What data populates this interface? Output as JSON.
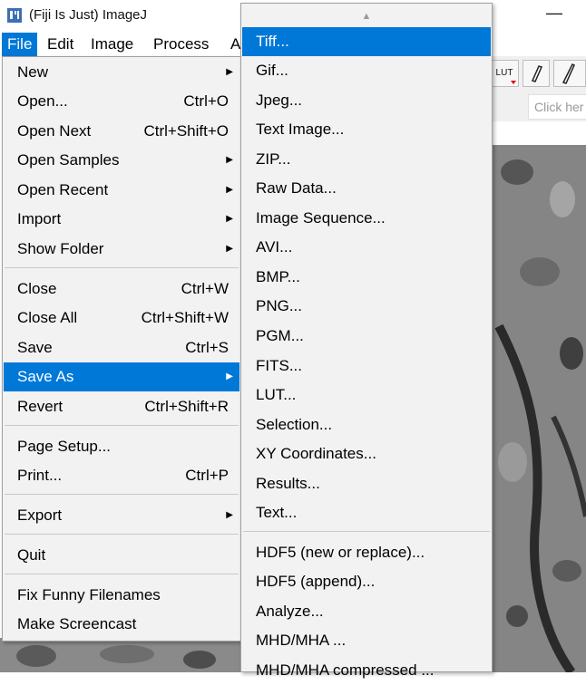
{
  "window": {
    "title": "(Fiji Is Just) ImageJ",
    "minimize_glyph": "—",
    "icon": "fiji-icon"
  },
  "menubar": {
    "items": [
      "File",
      "Edit",
      "Image",
      "Process",
      "A"
    ]
  },
  "toolbar": {
    "lut_label": "LUT",
    "search_placeholder": "Click her"
  },
  "file_menu": {
    "items": [
      {
        "label": "New",
        "shortcut": "",
        "submenu": true
      },
      {
        "label": "Open...",
        "shortcut": "Ctrl+O",
        "submenu": false
      },
      {
        "label": "Open Next",
        "shortcut": "Ctrl+Shift+O",
        "submenu": false
      },
      {
        "label": "Open Samples",
        "shortcut": "",
        "submenu": true
      },
      {
        "label": "Open Recent",
        "shortcut": "",
        "submenu": true
      },
      {
        "label": "Import",
        "shortcut": "",
        "submenu": true
      },
      {
        "label": "Show Folder",
        "shortcut": "",
        "submenu": true
      },
      {
        "label": "Close",
        "shortcut": "Ctrl+W",
        "submenu": false
      },
      {
        "label": "Close All",
        "shortcut": "Ctrl+Shift+W",
        "submenu": false
      },
      {
        "label": "Save",
        "shortcut": "Ctrl+S",
        "submenu": false
      },
      {
        "label": "Save As",
        "shortcut": "",
        "submenu": true,
        "highlighted": true
      },
      {
        "label": "Revert",
        "shortcut": "Ctrl+Shift+R",
        "submenu": false
      },
      {
        "label": "Page Setup...",
        "shortcut": "",
        "submenu": false
      },
      {
        "label": "Print...",
        "shortcut": "Ctrl+P",
        "submenu": false
      },
      {
        "label": "Export",
        "shortcut": "",
        "submenu": true
      },
      {
        "label": "Quit",
        "shortcut": "",
        "submenu": false
      },
      {
        "label": "Fix Funny Filenames",
        "shortcut": "",
        "submenu": false
      },
      {
        "label": "Make Screencast",
        "shortcut": "",
        "submenu": false
      }
    ]
  },
  "save_as_menu": {
    "scroll_up_glyph": "▲",
    "items": [
      {
        "label": "Tiff...",
        "highlighted": true
      },
      {
        "label": "Gif..."
      },
      {
        "label": "Jpeg..."
      },
      {
        "label": "Text Image..."
      },
      {
        "label": "ZIP..."
      },
      {
        "label": "Raw Data..."
      },
      {
        "label": "Image Sequence..."
      },
      {
        "label": "AVI..."
      },
      {
        "label": "BMP..."
      },
      {
        "label": "PNG..."
      },
      {
        "label": "PGM..."
      },
      {
        "label": "FITS..."
      },
      {
        "label": "LUT..."
      },
      {
        "label": "Selection..."
      },
      {
        "label": "XY Coordinates..."
      },
      {
        "label": "Results..."
      },
      {
        "label": "Text..."
      },
      {
        "label": "HDF5 (new or replace)..."
      },
      {
        "label": "HDF5 (append)..."
      },
      {
        "label": "Analyze..."
      },
      {
        "label": "MHD/MHA ..."
      },
      {
        "label": "MHD/MHA compressed ..."
      }
    ]
  },
  "colors": {
    "highlight": "#0078d7",
    "menu_bg": "#f2f2f2"
  }
}
